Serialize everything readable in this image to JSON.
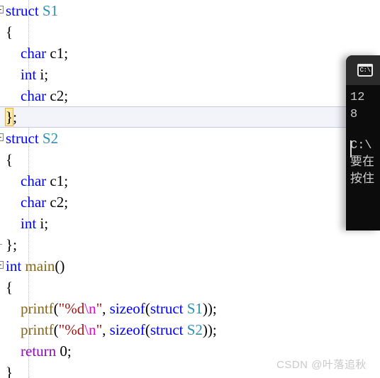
{
  "editor": {
    "name": "visual-studio-code-editor",
    "language": "C",
    "colors": {
      "background": "#ffffff",
      "keyword": "#0000ff",
      "type_name": "#2b91af",
      "function_name": "#86651a",
      "string": "#a31515",
      "escape_sequence": "#e000e0",
      "return_keyword": "#8f08c4",
      "current_line_background": "#f3f3fa",
      "brace_match_highlight": "#ffe9a8"
    },
    "lines": [
      {
        "n": 1,
        "fold": "start",
        "tokens": [
          {
            "t": "struct ",
            "c": "kw"
          },
          {
            "t": "S1",
            "c": "type"
          }
        ]
      },
      {
        "n": 2,
        "fold": "none",
        "tokens": [
          {
            "t": "{",
            "c": "plain"
          }
        ]
      },
      {
        "n": 3,
        "fold": "none",
        "tokens": [
          {
            "t": "    ",
            "c": "plain"
          },
          {
            "t": "char",
            "c": "kw"
          },
          {
            "t": " c1;",
            "c": "plain"
          }
        ]
      },
      {
        "n": 4,
        "fold": "none",
        "tokens": [
          {
            "t": "    ",
            "c": "plain"
          },
          {
            "t": "int",
            "c": "kw"
          },
          {
            "t": " i;",
            "c": "plain"
          }
        ]
      },
      {
        "n": 5,
        "fold": "none",
        "tokens": [
          {
            "t": "    ",
            "c": "plain"
          },
          {
            "t": "char",
            "c": "kw"
          },
          {
            "t": " c2;",
            "c": "plain"
          }
        ]
      },
      {
        "n": 6,
        "fold": "none",
        "current": true,
        "tokens": [
          {
            "t": "}",
            "c": "brace-hl"
          },
          {
            "t": ";",
            "c": "plain"
          }
        ]
      },
      {
        "n": 7,
        "fold": "start",
        "tokens": [
          {
            "t": "struct ",
            "c": "kw"
          },
          {
            "t": "S2",
            "c": "type"
          }
        ]
      },
      {
        "n": 8,
        "fold": "none",
        "tokens": [
          {
            "t": "{",
            "c": "plain"
          }
        ]
      },
      {
        "n": 9,
        "fold": "none",
        "tokens": [
          {
            "t": "    ",
            "c": "plain"
          },
          {
            "t": "char",
            "c": "kw"
          },
          {
            "t": " c1;",
            "c": "plain"
          }
        ]
      },
      {
        "n": 10,
        "fold": "none",
        "tokens": [
          {
            "t": "    ",
            "c": "plain"
          },
          {
            "t": "char",
            "c": "kw"
          },
          {
            "t": " c2;",
            "c": "plain"
          }
        ]
      },
      {
        "n": 11,
        "fold": "none",
        "tokens": [
          {
            "t": "    ",
            "c": "plain"
          },
          {
            "t": "int",
            "c": "kw"
          },
          {
            "t": " i;",
            "c": "plain"
          }
        ]
      },
      {
        "n": 12,
        "fold": "end",
        "tokens": [
          {
            "t": "};",
            "c": "plain"
          }
        ]
      },
      {
        "n": 13,
        "fold": "start",
        "tokens": [
          {
            "t": "int",
            "c": "kw"
          },
          {
            "t": " ",
            "c": "plain"
          },
          {
            "t": "main",
            "c": "fn"
          },
          {
            "t": "()",
            "c": "plain"
          }
        ]
      },
      {
        "n": 14,
        "fold": "none",
        "tokens": [
          {
            "t": "{",
            "c": "plain"
          }
        ]
      },
      {
        "n": 15,
        "fold": "none",
        "tokens": [
          {
            "t": "    ",
            "c": "plain"
          },
          {
            "t": "printf",
            "c": "fn"
          },
          {
            "t": "(",
            "c": "plain"
          },
          {
            "t": "\"%d",
            "c": "str"
          },
          {
            "t": "\\n",
            "c": "esc"
          },
          {
            "t": "\"",
            "c": "str"
          },
          {
            "t": ", ",
            "c": "plain"
          },
          {
            "t": "sizeof",
            "c": "kw"
          },
          {
            "t": "(",
            "c": "plain"
          },
          {
            "t": "struct ",
            "c": "kw"
          },
          {
            "t": "S1",
            "c": "type"
          },
          {
            "t": "));",
            "c": "plain"
          }
        ]
      },
      {
        "n": 16,
        "fold": "none",
        "tokens": [
          {
            "t": "    ",
            "c": "plain"
          },
          {
            "t": "printf",
            "c": "fn"
          },
          {
            "t": "(",
            "c": "plain"
          },
          {
            "t": "\"%d",
            "c": "str"
          },
          {
            "t": "\\n",
            "c": "esc"
          },
          {
            "t": "\"",
            "c": "str"
          },
          {
            "t": ", ",
            "c": "plain"
          },
          {
            "t": "sizeof",
            "c": "kw"
          },
          {
            "t": "(",
            "c": "plain"
          },
          {
            "t": "struct ",
            "c": "kw"
          },
          {
            "t": "S2",
            "c": "type"
          },
          {
            "t": "));",
            "c": "plain"
          }
        ]
      },
      {
        "n": 17,
        "fold": "none",
        "tokens": [
          {
            "t": "    ",
            "c": "plain"
          },
          {
            "t": "return",
            "c": "ret"
          },
          {
            "t": " 0;",
            "c": "plain"
          }
        ]
      },
      {
        "n": 18,
        "fold": "none",
        "tokens": [
          {
            "t": "}",
            "c": "plain"
          }
        ]
      }
    ]
  },
  "console": {
    "name": "command-prompt-window",
    "icon": "command-prompt-icon",
    "icon_label": "C:\\",
    "title": "",
    "background": "#0c0c0c",
    "titlebar_background": "#2b2b2b",
    "output_lines": [
      "12",
      "8",
      "",
      "C:\\",
      "要在",
      "按住"
    ]
  },
  "watermark": {
    "text": "CSDN @叶落追秋"
  }
}
